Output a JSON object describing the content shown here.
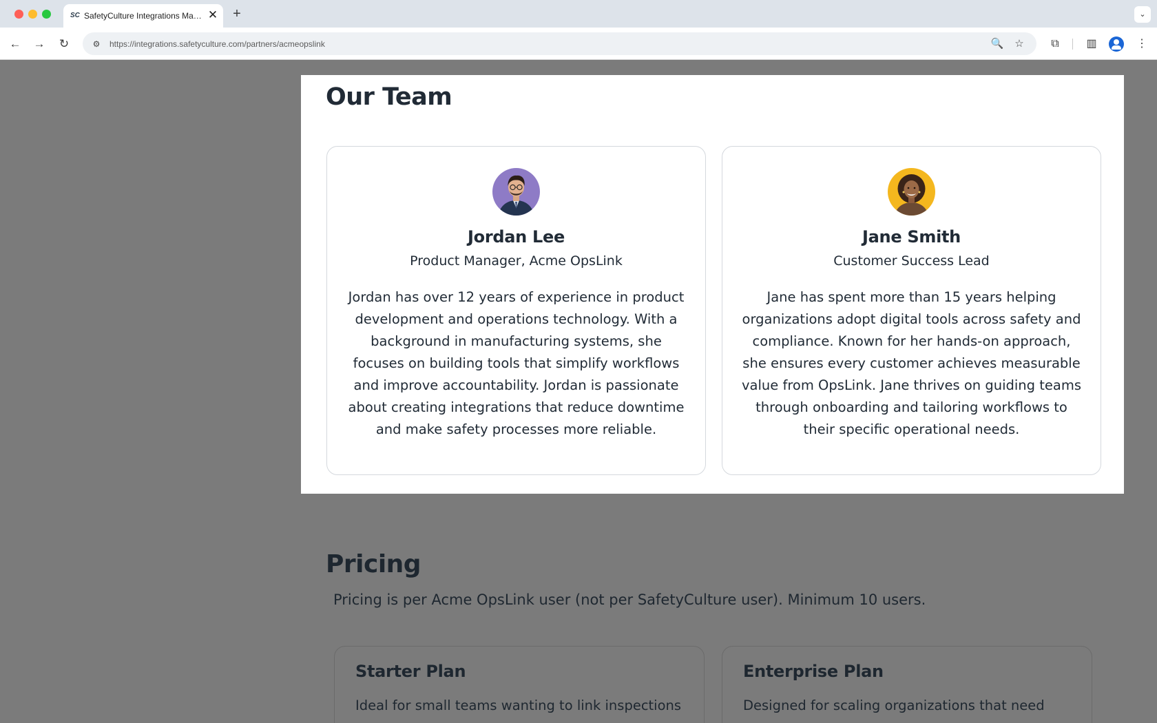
{
  "browser": {
    "tab_title": "SafetyCulture Integrations Market…",
    "tab_favicon": "SC",
    "tab_close_icon": "close-icon",
    "url": "https://integrations.safetyculture.com/partners/acmeopslink"
  },
  "team": {
    "title": "Our Team",
    "members": [
      {
        "name": "Jordan Lee",
        "role": "Product Manager, Acme OpsLink",
        "bio": "Jordan has over 12 years of experience in product development and operations technology. With a background in manufacturing systems, she focuses on building tools that simplify workflows and improve accountability. Jordan is passionate about creating integrations that reduce downtime and make safety processes more reliable.",
        "avatar_bg": "#8e7bc6"
      },
      {
        "name": "Jane Smith",
        "role": "Customer Success Lead",
        "bio": "Jane has spent more than 15 years helping organizations adopt digital tools across safety and compliance. Known for her hands-on approach, she ensures every customer achieves measurable value from OpsLink. Jane thrives on guiding teams through onboarding and tailoring workflows to their specific operational needs.",
        "avatar_bg": "#f4b71e"
      }
    ]
  },
  "pricing": {
    "title": "Pricing",
    "description": "Pricing is per Acme OpsLink user (not per SafetyCulture user). Minimum 10 users.",
    "plans": [
      {
        "name": "Starter Plan",
        "description": "Ideal for small teams wanting to link inspections"
      },
      {
        "name": "Enterprise Plan",
        "description": "Designed for scaling organizations that need"
      }
    ]
  },
  "colors": {
    "text_dark": "#212b36",
    "overlay": "#7b7b7b",
    "card_border": "#d4d8dd"
  }
}
